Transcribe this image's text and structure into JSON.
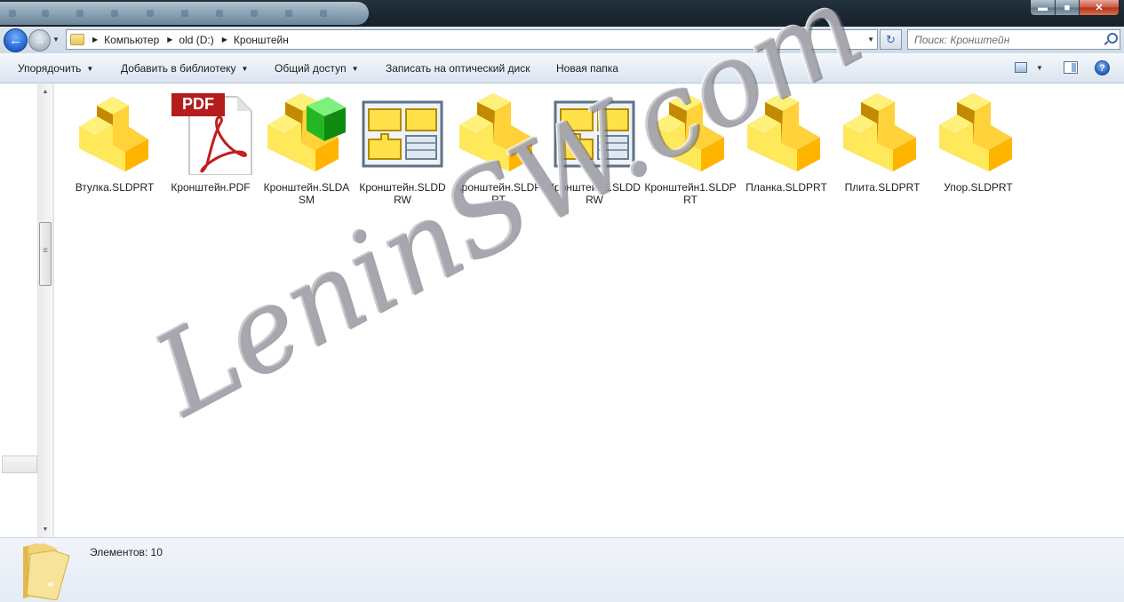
{
  "window": {
    "minimize": "▬",
    "maximize": "■",
    "close": "✕"
  },
  "address": {
    "breadcrumbs": [
      "Компьютер",
      "old (D:)",
      "Кронштейн"
    ]
  },
  "search": {
    "placeholder": "Поиск: Кронштейн"
  },
  "toolbar": {
    "organize": "Упорядочить",
    "add_library": "Добавить в библиотеку",
    "share": "Общий доступ",
    "burn": "Записать на оптический диск",
    "new_folder": "Новая папка",
    "help": "?"
  },
  "files": [
    {
      "name": "Втулка.SLDPRT",
      "icon": "solidworks-part-icon"
    },
    {
      "name": "Кронштейн.PDF",
      "icon": "pdf-icon"
    },
    {
      "name": "Кронштейн.SLDASM",
      "icon": "solidworks-assembly-icon"
    },
    {
      "name": "Кронштейн.SLDDRW",
      "icon": "solidworks-drawing-icon"
    },
    {
      "name": "Кронштейн.SLDPRT",
      "icon": "solidworks-part-icon"
    },
    {
      "name": "Кронштейн1.SLDDRW",
      "icon": "solidworks-drawing-icon"
    },
    {
      "name": "Кронштейн1.SLDPRT",
      "icon": "solidworks-part-icon"
    },
    {
      "name": "Планка.SLDPRT",
      "icon": "solidworks-part-icon"
    },
    {
      "name": "Плита.SLDPRT",
      "icon": "solidworks-part-icon"
    },
    {
      "name": "Упор.SLDPRT",
      "icon": "solidworks-part-icon"
    }
  ],
  "pdf_badge": "PDF",
  "watermark": "LeninSW.com",
  "status": {
    "items_count": "Элементов: 10"
  },
  "colors": {
    "part_yellow": "#ffd800",
    "assembly_green": "#1fb51f",
    "accent_blue": "#245fb3"
  }
}
